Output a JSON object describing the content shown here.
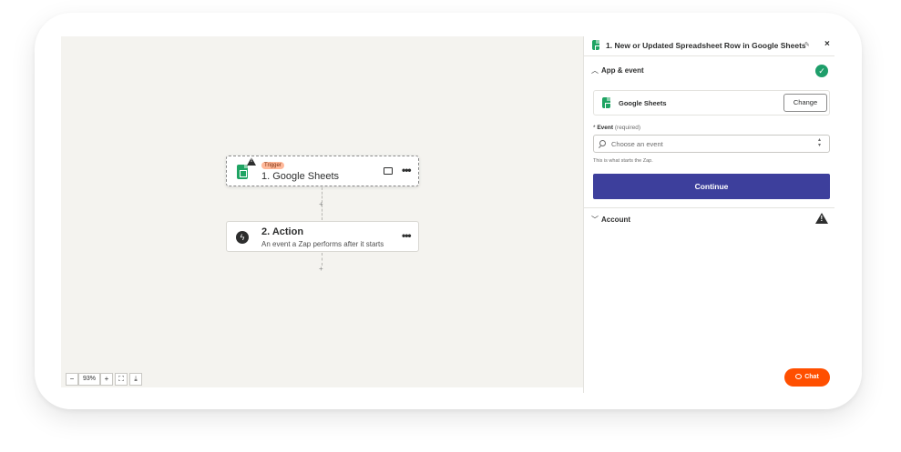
{
  "canvas": {
    "trigger_step": {
      "badge": "Trigger",
      "title": "1. Google Sheets",
      "more_icon": "ellipsis-icon",
      "comment_icon": "comment-icon",
      "warning_icon": "warning-icon"
    },
    "action_step": {
      "title": "2. Action",
      "subtitle": "An event a Zap performs after it starts",
      "more_icon": "ellipsis-icon"
    },
    "connector_plus": "+",
    "zoom": {
      "minus": "−",
      "level": "93%",
      "plus": "+",
      "fit_icon": "fit-screen-icon",
      "download_icon": "download-icon"
    }
  },
  "panel": {
    "title": "1. New or Updated Spreadsheet Row in Google Sheets",
    "edit_icon": "pencil-icon",
    "close_label": "×",
    "app_event": {
      "label": "App & event",
      "status_icon": "check-circle-icon",
      "app_name": "Google Sheets",
      "change_label": "Change",
      "event_label": "Event",
      "event_required": "(required)",
      "event_placeholder": "Choose an event",
      "helper_text": "This is what starts the Zap.",
      "continue_label": "Continue"
    },
    "account": {
      "label": "Account",
      "status_icon": "warning-icon"
    },
    "chat_label": "Chat"
  },
  "colors": {
    "canvas_bg": "#f4f3ef",
    "continue_bg": "#3d3f9c",
    "chat_bg": "#ff4f00",
    "success": "#1e9e6a",
    "sheets_green": "#1fa463",
    "trigger_badge": "#ffb899"
  }
}
